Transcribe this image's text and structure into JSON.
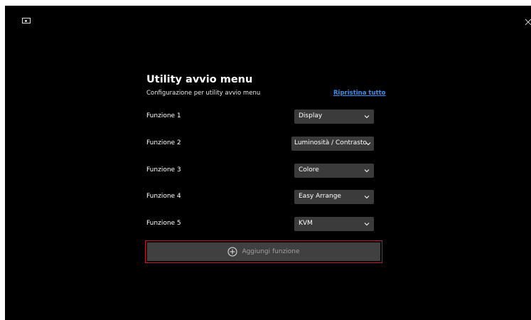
{
  "window": {
    "monitor_icon": "monitor-icon",
    "close_icon": "close-icon"
  },
  "panel": {
    "title": "Utility avvio menu",
    "subtitle": "Configurazione per utility avvio menu",
    "reset_label": "Ripristina tutto",
    "rows": [
      {
        "label": "Funzione 1",
        "value": "Display"
      },
      {
        "label": "Funzione 2",
        "value": "Luminosità / Contrasto"
      },
      {
        "label": "Funzione 3",
        "value": "Colore"
      },
      {
        "label": "Funzione 4",
        "value": "Easy Arrange"
      },
      {
        "label": "Funzione 5",
        "value": "KVM"
      }
    ],
    "add_label": "Aggiungi funzione"
  },
  "colors": {
    "background": "#000000",
    "link": "#3b8ee6",
    "select_bg": "#3b3b3b",
    "add_bg": "#404040",
    "highlight": "#c0182a"
  }
}
